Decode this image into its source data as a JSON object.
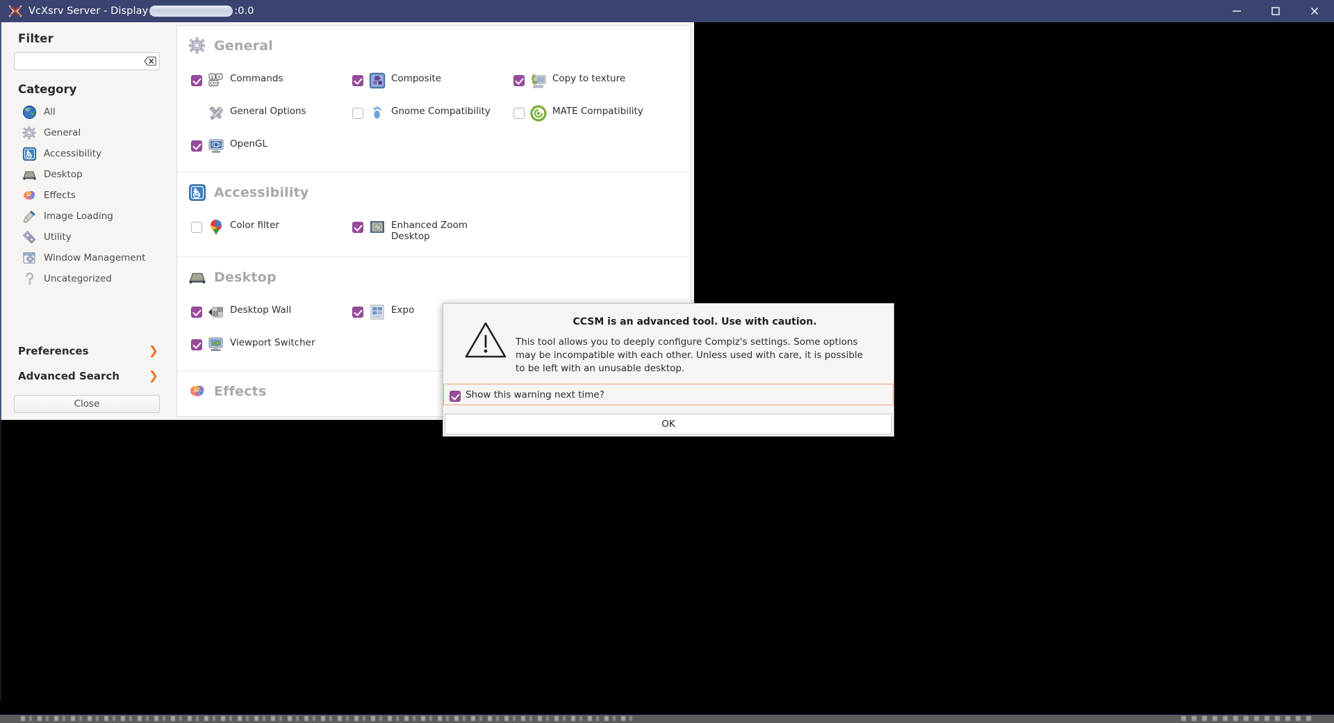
{
  "window": {
    "title_prefix": "VcXsrv Server - Display",
    "title_suffix": ":0.0",
    "icon": "vcxsrv-x-icon",
    "controls": {
      "minimize": "minimize-icon",
      "maximize": "maximize-icon",
      "close": "close-icon"
    },
    "titlebar_color": "#3b4470"
  },
  "sidebar": {
    "filter_heading": "Filter",
    "filter_value": "",
    "filter_placeholder": "",
    "filter_clear_icon": "clear-backspace-icon",
    "category_heading": "Category",
    "categories": [
      {
        "label": "All",
        "icon": "globe-icon"
      },
      {
        "label": "General",
        "icon": "gear-icon"
      },
      {
        "label": "Accessibility",
        "icon": "accessibility-icon"
      },
      {
        "label": "Desktop",
        "icon": "desktop-icon"
      },
      {
        "label": "Effects",
        "icon": "effects-burst-icon"
      },
      {
        "label": "Image Loading",
        "icon": "paintbrush-icon"
      },
      {
        "label": "Utility",
        "icon": "gears-icon"
      },
      {
        "label": "Window Management",
        "icon": "window-gear-icon"
      },
      {
        "label": "Uncategorized",
        "icon": "question-mark-icon"
      }
    ],
    "links": [
      {
        "label": "Preferences",
        "chevron": "chevron-right-icon"
      },
      {
        "label": "Advanced Search",
        "chevron": "chevron-right-icon"
      }
    ],
    "close_label": "Close"
  },
  "main": {
    "sections": [
      {
        "title": "General",
        "icon": "gear-icon",
        "plugins": [
          {
            "label": "Commands",
            "checked": true,
            "has_checkbox": true,
            "icon": "keyboard-keys-icon"
          },
          {
            "label": "Composite",
            "checked": true,
            "has_checkbox": true,
            "icon": "composite-puzzle-icon"
          },
          {
            "label": "Copy to texture",
            "checked": true,
            "has_checkbox": true,
            "icon": "copy-texture-icon"
          },
          {
            "label": "General Options",
            "checked": false,
            "has_checkbox": false,
            "icon": "tools-wrench-icon"
          },
          {
            "label": "Gnome Compatibility",
            "checked": false,
            "has_checkbox": true,
            "icon": "gnome-foot-icon"
          },
          {
            "label": "MATE Compatibility",
            "checked": false,
            "has_checkbox": true,
            "icon": "mate-icon"
          },
          {
            "label": "OpenGL",
            "checked": true,
            "has_checkbox": true,
            "icon": "opengl-monitor-icon"
          }
        ]
      },
      {
        "title": "Accessibility",
        "icon": "accessibility-icon",
        "plugins": [
          {
            "label": "Color filter",
            "checked": false,
            "has_checkbox": true,
            "icon": "color-filter-icon"
          },
          {
            "label": "Enhanced Zoom Desktop",
            "checked": true,
            "has_checkbox": true,
            "icon": "enhanced-zoom-icon"
          }
        ]
      },
      {
        "title": "Desktop",
        "icon": "desktop-icon",
        "plugins": [
          {
            "label": "Desktop Wall",
            "checked": true,
            "has_checkbox": true,
            "icon": "desktop-wall-icon"
          },
          {
            "label": "Expo",
            "checked": true,
            "has_checkbox": true,
            "icon": "expo-grid-icon"
          },
          {
            "label": "Viewport Switcher",
            "checked": true,
            "has_checkbox": true,
            "icon": "viewport-switcher-icon"
          }
        ]
      },
      {
        "title": "Effects",
        "icon": "effects-burst-icon",
        "plugins": []
      }
    ]
  },
  "dialog": {
    "warning_icon": "warning-triangle-icon",
    "title": "CCSM is an advanced tool. Use with caution.",
    "message": "This tool allows you to deeply configure Compiz's settings. Some options may be incompatible with each other. Unless used with care, it is possible to be left with an unusable desktop.",
    "checkbox_label": "Show this warning next time?",
    "checkbox_checked": true,
    "ok_label": "OK",
    "accent_border": "#f0a383",
    "checkbox_color": "#994a9c"
  }
}
